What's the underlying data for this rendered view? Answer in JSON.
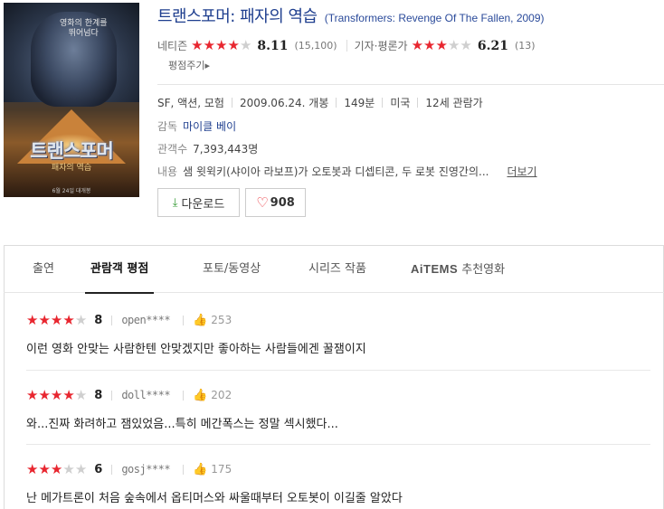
{
  "poster": {
    "tagline": "영화의 한계를\n뛰어넘다",
    "title": "트랜스포머",
    "subtitle": "패자의 역습",
    "date": "6월 24일 대개봉"
  },
  "movie": {
    "title": "트랜스포머: 패자의 역습",
    "original_title": "(Transformers: Revenge Of The Fallen, 2009)"
  },
  "ratings": {
    "netizen": {
      "label": "네티즌",
      "stars": 4,
      "score": "8.11",
      "count": "(15,100)"
    },
    "critic": {
      "label": "기자·평론가",
      "stars": 3,
      "score": "6.21",
      "count": "(13)"
    },
    "rate_button": "평점주기▸"
  },
  "info": {
    "genre": "SF, 액션, 모험",
    "release": "2009.06.24. 개봉",
    "runtime": "149분",
    "country": "미국",
    "age": "12세 관람가",
    "director_label": "감독",
    "director": "마이클 베이",
    "audience_label": "관객수",
    "audience": "7,393,443명",
    "plot_label": "내용",
    "plot": "샘 윗윅키(샤이아 라보프)가 오토봇과 디셉티콘, 두 로봇 진영간의...",
    "more": "더보기"
  },
  "buttons": {
    "download": "다운로드",
    "like_count": "908"
  },
  "tabs": [
    {
      "label": "출연"
    },
    {
      "label": "관람객 평점"
    },
    {
      "label": "포토/동영상"
    },
    {
      "label": "시리즈 작품"
    },
    {
      "logo": "AiTEMS",
      "label": "추천영화"
    }
  ],
  "reviews": [
    {
      "stars": 4,
      "score": "8",
      "user": "open****",
      "likes": "253",
      "text": "이런 영화 안맞는 사람한텐 안맞겠지만 좋아하는 사람들에겐 꿀잼이지"
    },
    {
      "stars": 4,
      "score": "8",
      "user": "doll****",
      "likes": "202",
      "text": "와...진짜 화려하고 잼있었음...특히 메간폭스는 정말 섹시했다..."
    },
    {
      "stars": 3,
      "score": "6",
      "user": "gosj****",
      "likes": "175",
      "text": "난 메가트론이 처음 숲속에서 옵티머스와 싸울때부터 오토봇이 이길줄 알았다"
    }
  ],
  "colors": {
    "star_on": "#e8262f",
    "star_off": "#cfcfcf",
    "link": "#1f3f8f",
    "download_icon": "#3a9d3a"
  }
}
